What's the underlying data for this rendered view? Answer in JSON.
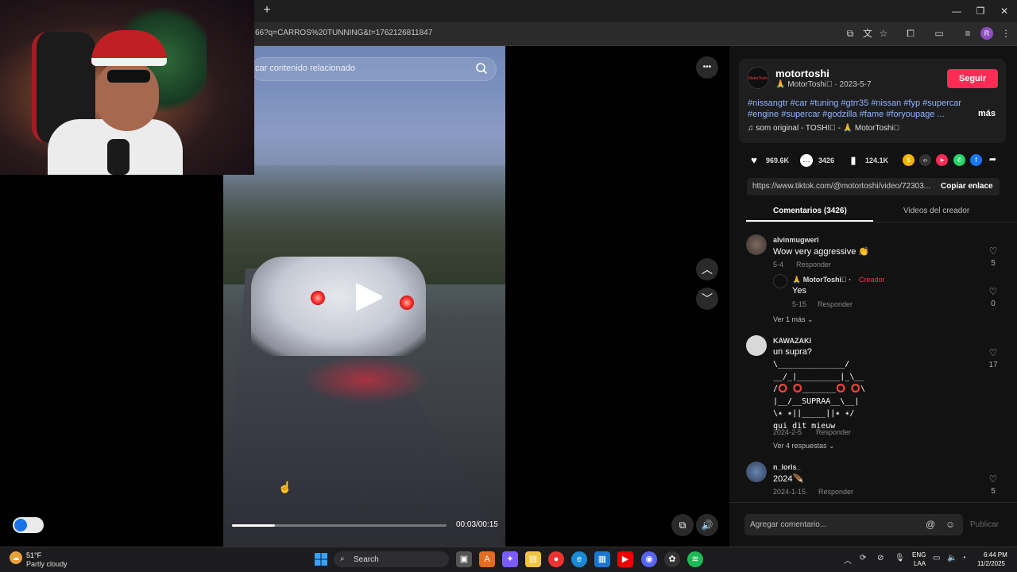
{
  "browser": {
    "new_tab": "+",
    "url": "66?q=CARROS%20TUNNING&t=1762126811847",
    "profile_initial": "R",
    "window_controls": [
      "minimize-icon",
      "restore-icon",
      "close-icon"
    ]
  },
  "video": {
    "search_placeholder": "car contenido relacionado",
    "timecode": "00:03/00:15",
    "progress": 0.2,
    "controls": {
      "more_label": "•••",
      "up": "chevron-up-icon",
      "down": "chevron-down-icon"
    }
  },
  "creator": {
    "username": "motortoshi",
    "display": "🙏 MotorToshi🏽 · 2023-5-7",
    "avatar_text": "MotorToshi",
    "follow_label": "Seguir",
    "description": "#nissangtr #car #tuning #gtrr35 #nissan #fyp #supercar #engine #supercar #godzilla #fame #foryoupage ...",
    "more_label": "más",
    "music": "♫  som original - TOSHI🏽 - 🙏 MotorToshi🏽"
  },
  "stats": {
    "likes": "969.6K",
    "comments": "3426",
    "saves": "124.1K"
  },
  "share": {
    "link": "https://www.tiktok.com/@motortoshi/video/72303...",
    "copy_label": "Copiar enlace"
  },
  "tabs": {
    "comments": "Comentarios (3426)",
    "videos": "Videos del creador"
  },
  "comments": [
    {
      "user": "alvinmugweri",
      "text": "Wow very aggressive 👏",
      "date": "5-4",
      "reply": "Responder",
      "likes": "5",
      "replies": [
        {
          "user": "🙏 MotorToshi🏽 · ",
          "creator_tag": "Creador",
          "text": "Yes",
          "date": "5-15",
          "reply": "Responder",
          "likes": "0"
        }
      ],
      "more_replies": "Ver 1 más  ⌄"
    },
    {
      "user": "KAWAZAKI",
      "text": "un supra?",
      "art": "\\______________/\n__/_|_________|_\\__\n/⭕ ⭕_______⭕ ⭕\\\n|__/__SUPRAA__\\__|\n\\✴ ✴||_____||✴ ✴/\nqui dit mieuw",
      "date": "2024-2-5",
      "reply": "Responder",
      "likes": "17",
      "more_replies": "Ver 4 respuestas  ⌄"
    },
    {
      "user": "n_loris_",
      "text": "2024🪶",
      "date": "2024-1-15",
      "reply": "Responder",
      "likes": "5"
    }
  ],
  "comment_box": {
    "placeholder": "Agregar comentario...",
    "publish_label": "Publicar"
  },
  "taskbar": {
    "weather_temp": "51°F",
    "weather_desc": "Partly cloudy",
    "search_label": "Search",
    "lang_top": "ENG",
    "lang_bottom": "LAA",
    "time": "6:44 PM",
    "date": "11/2/2025"
  },
  "colors": {
    "accent": "#fe2c55",
    "hashtag": "#8fb3ff",
    "panel_bg": "#121212"
  }
}
